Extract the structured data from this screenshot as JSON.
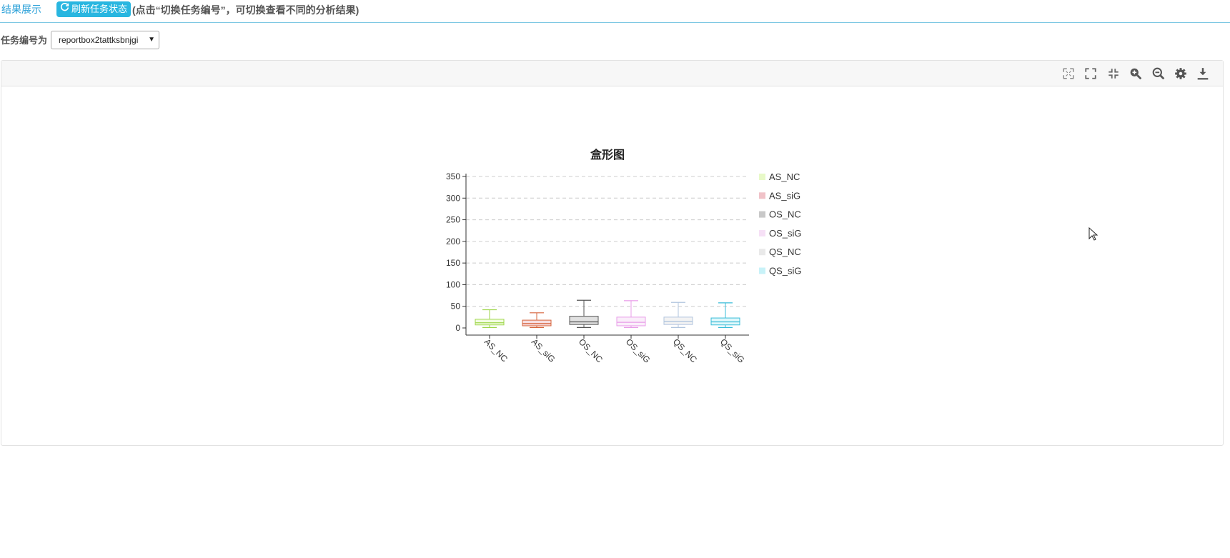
{
  "header": {
    "tab_label": "结果展示",
    "refresh_label": "刷新任务状态",
    "hint": "(点击“切换任务编号”，可切换查看不同的分析结果)"
  },
  "task": {
    "label": "任务编号为",
    "selected": "reportbox2tattksbnjgi"
  },
  "toolbar": {
    "icons": [
      "fit-screen-icon",
      "fullscreen-icon",
      "exit-fullscreen-icon",
      "zoom-in-icon",
      "zoom-out-icon",
      "settings-icon",
      "download-icon"
    ]
  },
  "colors": {
    "accent": "#29b6e0",
    "link": "#2aa0d8"
  },
  "chart_data": {
    "type": "box",
    "title": "盒形图",
    "xlabel": "",
    "ylabel": "",
    "ylim": [
      0,
      350
    ],
    "yticks": [
      0,
      50,
      100,
      150,
      200,
      250,
      300,
      350
    ],
    "grid": true,
    "legend_position": "right",
    "categories": [
      "AS_NC",
      "AS_siG",
      "OS_NC",
      "OS_siG",
      "QS_NC",
      "QS_siG"
    ],
    "series": [
      {
        "name": "AS_NC",
        "color": "#9ed64a",
        "legend_color": "#e8f9c8",
        "min": 1,
        "q1": 7,
        "median": 12,
        "q3": 20,
        "max": 42
      },
      {
        "name": "AS_siG",
        "color": "#d6643c",
        "legend_color": "#f0c2c8",
        "min": 1,
        "q1": 5,
        "median": 10,
        "q3": 18,
        "max": 35
      },
      {
        "name": "OS_NC",
        "color": "#555555",
        "legend_color": "#c8c8c8",
        "min": 1,
        "q1": 8,
        "median": 14,
        "q3": 27,
        "max": 64
      },
      {
        "name": "OS_siG",
        "color": "#e89ce8",
        "legend_color": "#f6e0f6",
        "min": 1,
        "q1": 5,
        "median": 13,
        "q3": 25,
        "max": 63
      },
      {
        "name": "QS_NC",
        "color": "#b0c4de",
        "legend_color": "#e9e9e9",
        "min": 1,
        "q1": 8,
        "median": 15,
        "q3": 25,
        "max": 59
      },
      {
        "name": "QS_siG",
        "color": "#38bcd8",
        "legend_color": "#c8f2f8",
        "min": 1,
        "q1": 7,
        "median": 14,
        "q3": 23,
        "max": 58
      }
    ]
  }
}
